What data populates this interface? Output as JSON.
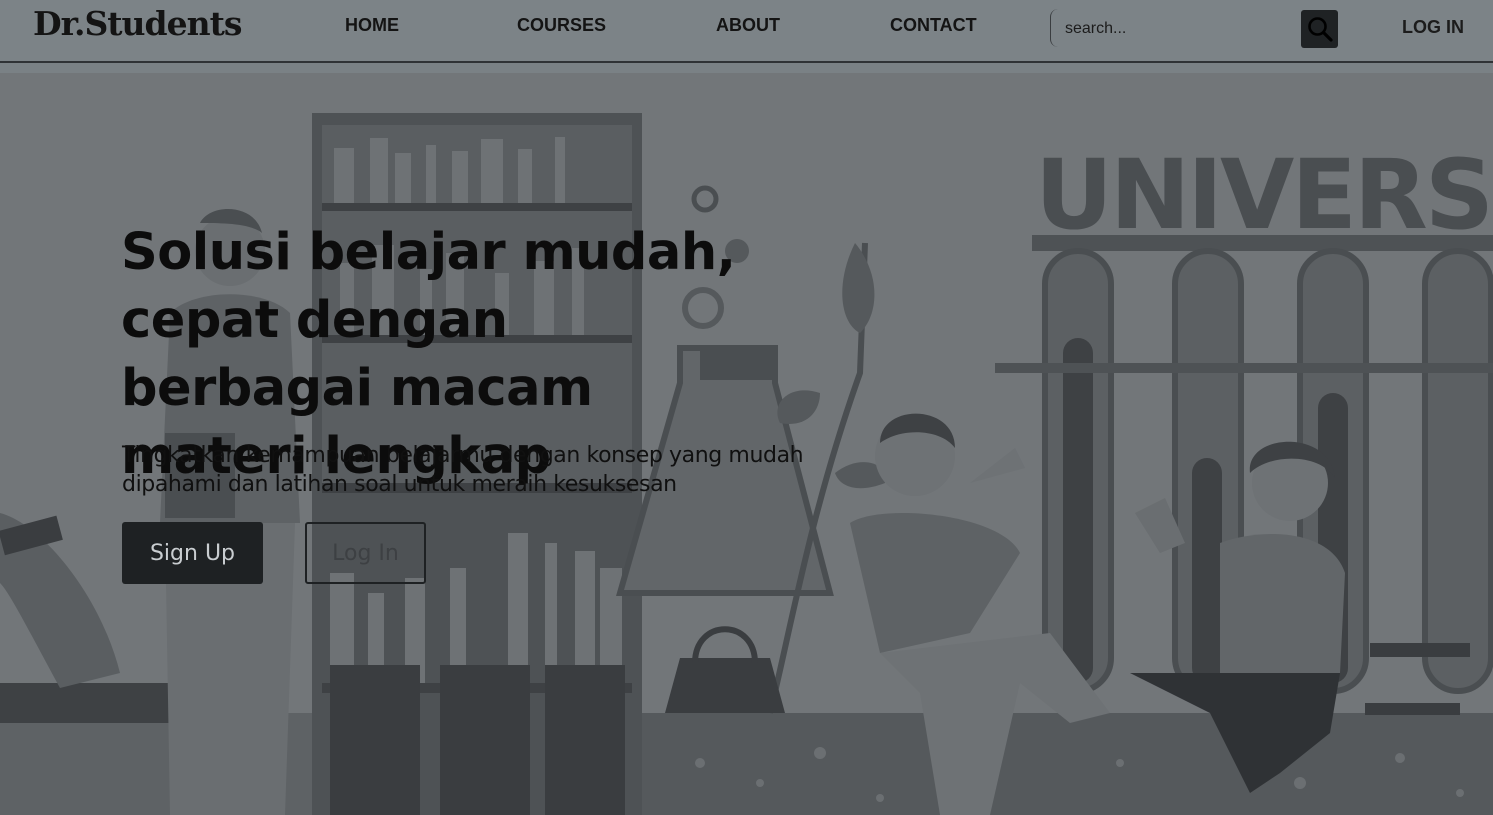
{
  "navbar": {
    "brand": "Dr.Students",
    "links": [
      "HOME",
      "COURSES",
      "ABOUT",
      "CONTACT"
    ],
    "search_placeholder": "search...",
    "login_label": "LOG IN"
  },
  "hero": {
    "title": "Solusi belajar mudah, cepat dengan berbagai macam materi lengkap",
    "subtitle": "Tingkatkan kemampuan belajarmu dengan konsep yang mudah dipahami dan latihan soal untuk meraih kesuksesan",
    "signup_label": "Sign Up",
    "login_label": "Log In",
    "background_sign": "UNIVERSITY"
  },
  "colors": {
    "navbar_bg": "#7c8387",
    "hero_overlay": "#727679",
    "button_dark": "#1e2123"
  },
  "icons": {
    "search": "search-icon"
  }
}
